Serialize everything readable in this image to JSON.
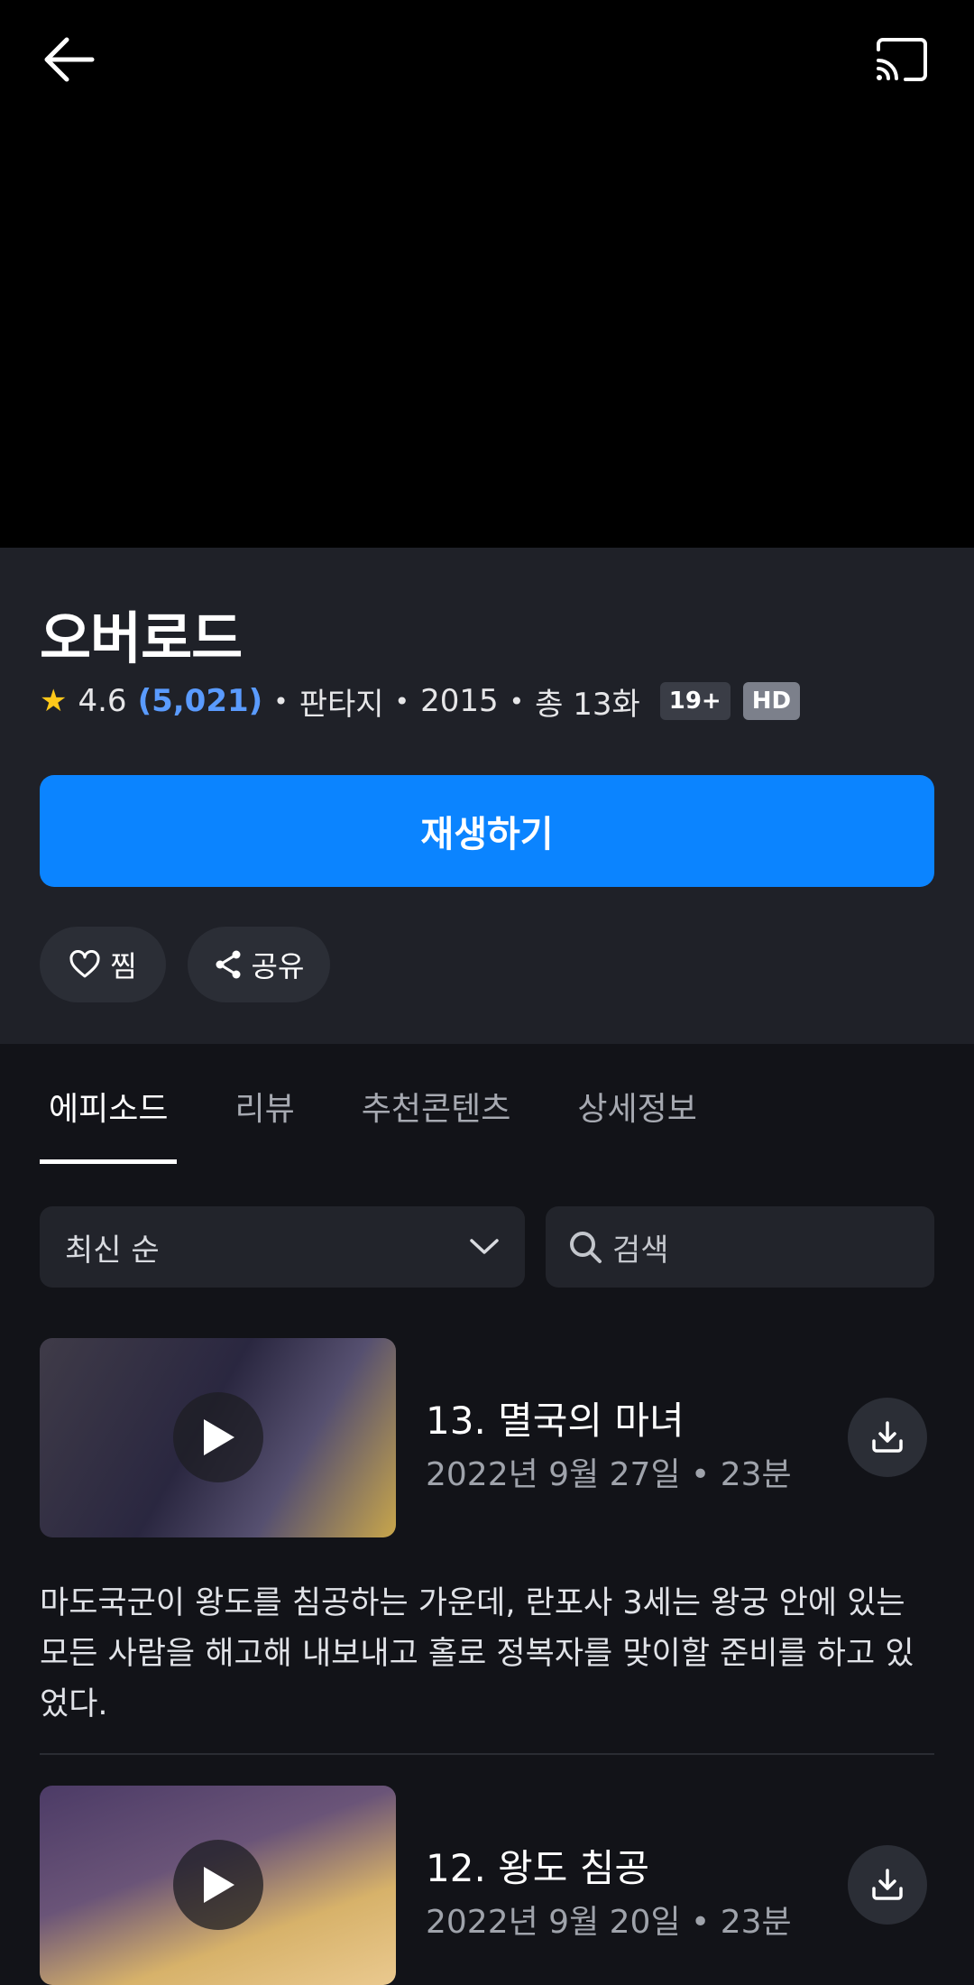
{
  "header": {
    "back_icon": "arrow-left-icon",
    "cast_icon": "cast-icon"
  },
  "show": {
    "title": "오버로드",
    "rating": "4.6",
    "rating_count": "(5,021)",
    "genre": "판타지",
    "year": "2015",
    "episodes_total": "총 13화",
    "age_badge": "19+",
    "quality_badge": "HD"
  },
  "actions": {
    "play_label": "재생하기",
    "like_label": "찜",
    "share_label": "공유"
  },
  "tabs": [
    {
      "label": "에피소드",
      "active": true
    },
    {
      "label": "리뷰",
      "active": false
    },
    {
      "label": "추천콘텐츠",
      "active": false
    },
    {
      "label": "상세정보",
      "active": false
    }
  ],
  "filters": {
    "sort_value": "최신 순",
    "search_placeholder": "검색"
  },
  "episodes": [
    {
      "title": "13. 멸국의 마녀",
      "date": "2022년 9월 27일",
      "duration": "23분",
      "description": "마도국군이 왕도를 침공하는 가운데, 란포사 3세는 왕궁 안에 있는 모든 사람을 해고해 내보내고 홀로 정복자를 맞이할 준비를 하고 있었다."
    },
    {
      "title": "12. 왕도 침공",
      "date": "2022년 9월 20일",
      "duration": "23분"
    }
  ]
}
